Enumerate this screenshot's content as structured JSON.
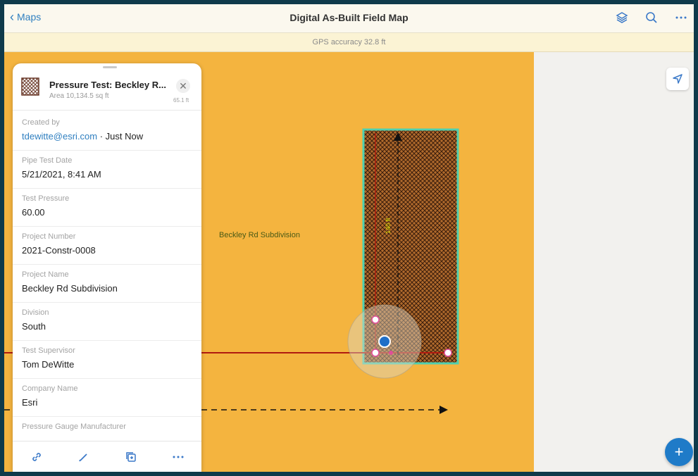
{
  "topbar": {
    "back_label": "Maps",
    "title": "Digital As-Built Field Map",
    "icons": [
      "layers-icon",
      "search-icon",
      "more-icon"
    ]
  },
  "gps": {
    "text": "GPS accuracy 32.8 ft"
  },
  "map": {
    "label": "Beckley Rd Subdivision",
    "measure_label": "140 ft",
    "colors": {
      "background": "#f4b43f",
      "polygon_outline": "#4fd0b0",
      "line": "#b01a10"
    }
  },
  "panel": {
    "title": "Pressure Test: Beckley R...",
    "subtitle": "Area 10,134.5 sq ft",
    "distance": "65.1 ft",
    "fields": [
      {
        "label": "Created by",
        "value_link": "tdewitte@esri.com",
        "value_rest": " · Just Now"
      },
      {
        "label": "Pipe Test Date",
        "value": "5/21/2021, 8:41 AM"
      },
      {
        "label": "Test Pressure",
        "value": "60.00"
      },
      {
        "label": "Project Number",
        "value": "2021-Constr-0008"
      },
      {
        "label": "Project Name",
        "value": "Beckley Rd Subdivision"
      },
      {
        "label": "Division",
        "value": "South"
      },
      {
        "label": "Test Supervisor",
        "value": "Tom DeWitte"
      },
      {
        "label": "Company Name",
        "value": "Esri"
      },
      {
        "label": "Pressure Gauge Manufacturer",
        "value": ""
      }
    ],
    "toolbar": [
      "link-icon",
      "edit-icon",
      "duplicate-icon",
      "more-icon"
    ]
  }
}
